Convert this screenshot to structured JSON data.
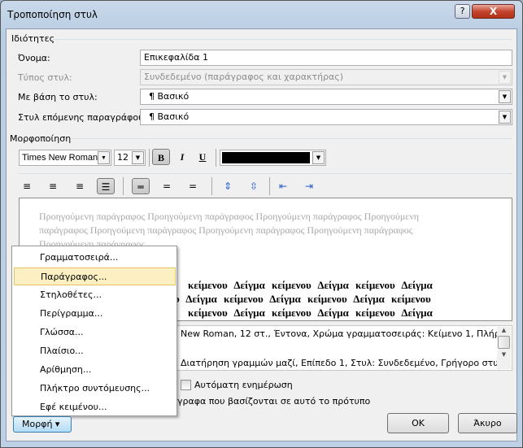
{
  "window": {
    "title": "Τροποποίηση στυλ",
    "help_label": "?",
    "close_label": "X"
  },
  "properties": {
    "group_label": "Ιδιότητες",
    "name_label": "Όνομα:",
    "name_value": "Επικεφαλίδα 1",
    "type_label": "Τύπος στυλ:",
    "type_value": "Συνδεδεμένο (παράγραφος και χαρακτήρας)",
    "based_label": "Με βάση το στυλ:",
    "based_value": "¶ Βασικό",
    "next_label": "Στυλ επόμενης παραγράφου:",
    "next_value": "¶ Βασικό"
  },
  "formatting": {
    "group_label": "Μορφοποίηση",
    "font": "Times New Roman",
    "size": "12",
    "bold": "B",
    "italic": "I",
    "underline": "U",
    "font_color": "#000000"
  },
  "preview": {
    "previous_lines": [
      "Προηγούμενη παράγραφος Προηγούμενη παράγραφος Προηγούμενη παράγραφος Προηγούμενη",
      "παράγραφος Προηγούμενη παράγραφος Προηγούμενη παράγραφος Προηγούμενη παράγραφος",
      "Προηγούμενη παράγραφος"
    ],
    "sample_lines": [
      "κείμενου Δείγμα κείμενου Δείγμα κείμενου Δείγμα",
      "υ Δείγμα κείμενου Δείγμα κείμενου Δείγμα κείμενου",
      "κείμενου Δείγμα κείμενου Δείγμα κείμενου Δείγμα"
    ]
  },
  "description": {
    "line1": "New Roman, 12 στ., Έντονα, Χρώμα γραμματοσειράς: Κείμενο 1, Πλήρης",
    "line2": "Διατήρηση γραμμών μαζί, Επίπεδο 1, Στυλ: Συνδεδεμένο, Γρήγορο στυλ,"
  },
  "options": {
    "auto_update_label": "Αυτόματη ενημέρωση",
    "auto_update_checked": false,
    "new_docs_fragment": "γραφα που βασίζονται σε αυτό το πρότυπο"
  },
  "menu": {
    "items": [
      "Γραμματοσειρά...",
      "Παράγραφος...",
      "Στηλοθέτες...",
      "Περίγραμμα...",
      "Γλώσσα...",
      "Πλαίσιο...",
      "Αρίθμηση...",
      "Πλήκτρο συντόμευσης...",
      "Εφέ κειμένου..."
    ],
    "highlighted": "Παράγραφος..."
  },
  "buttons": {
    "format": "Μορφή ▾",
    "ok": "OK",
    "cancel": "Άκυρο"
  }
}
